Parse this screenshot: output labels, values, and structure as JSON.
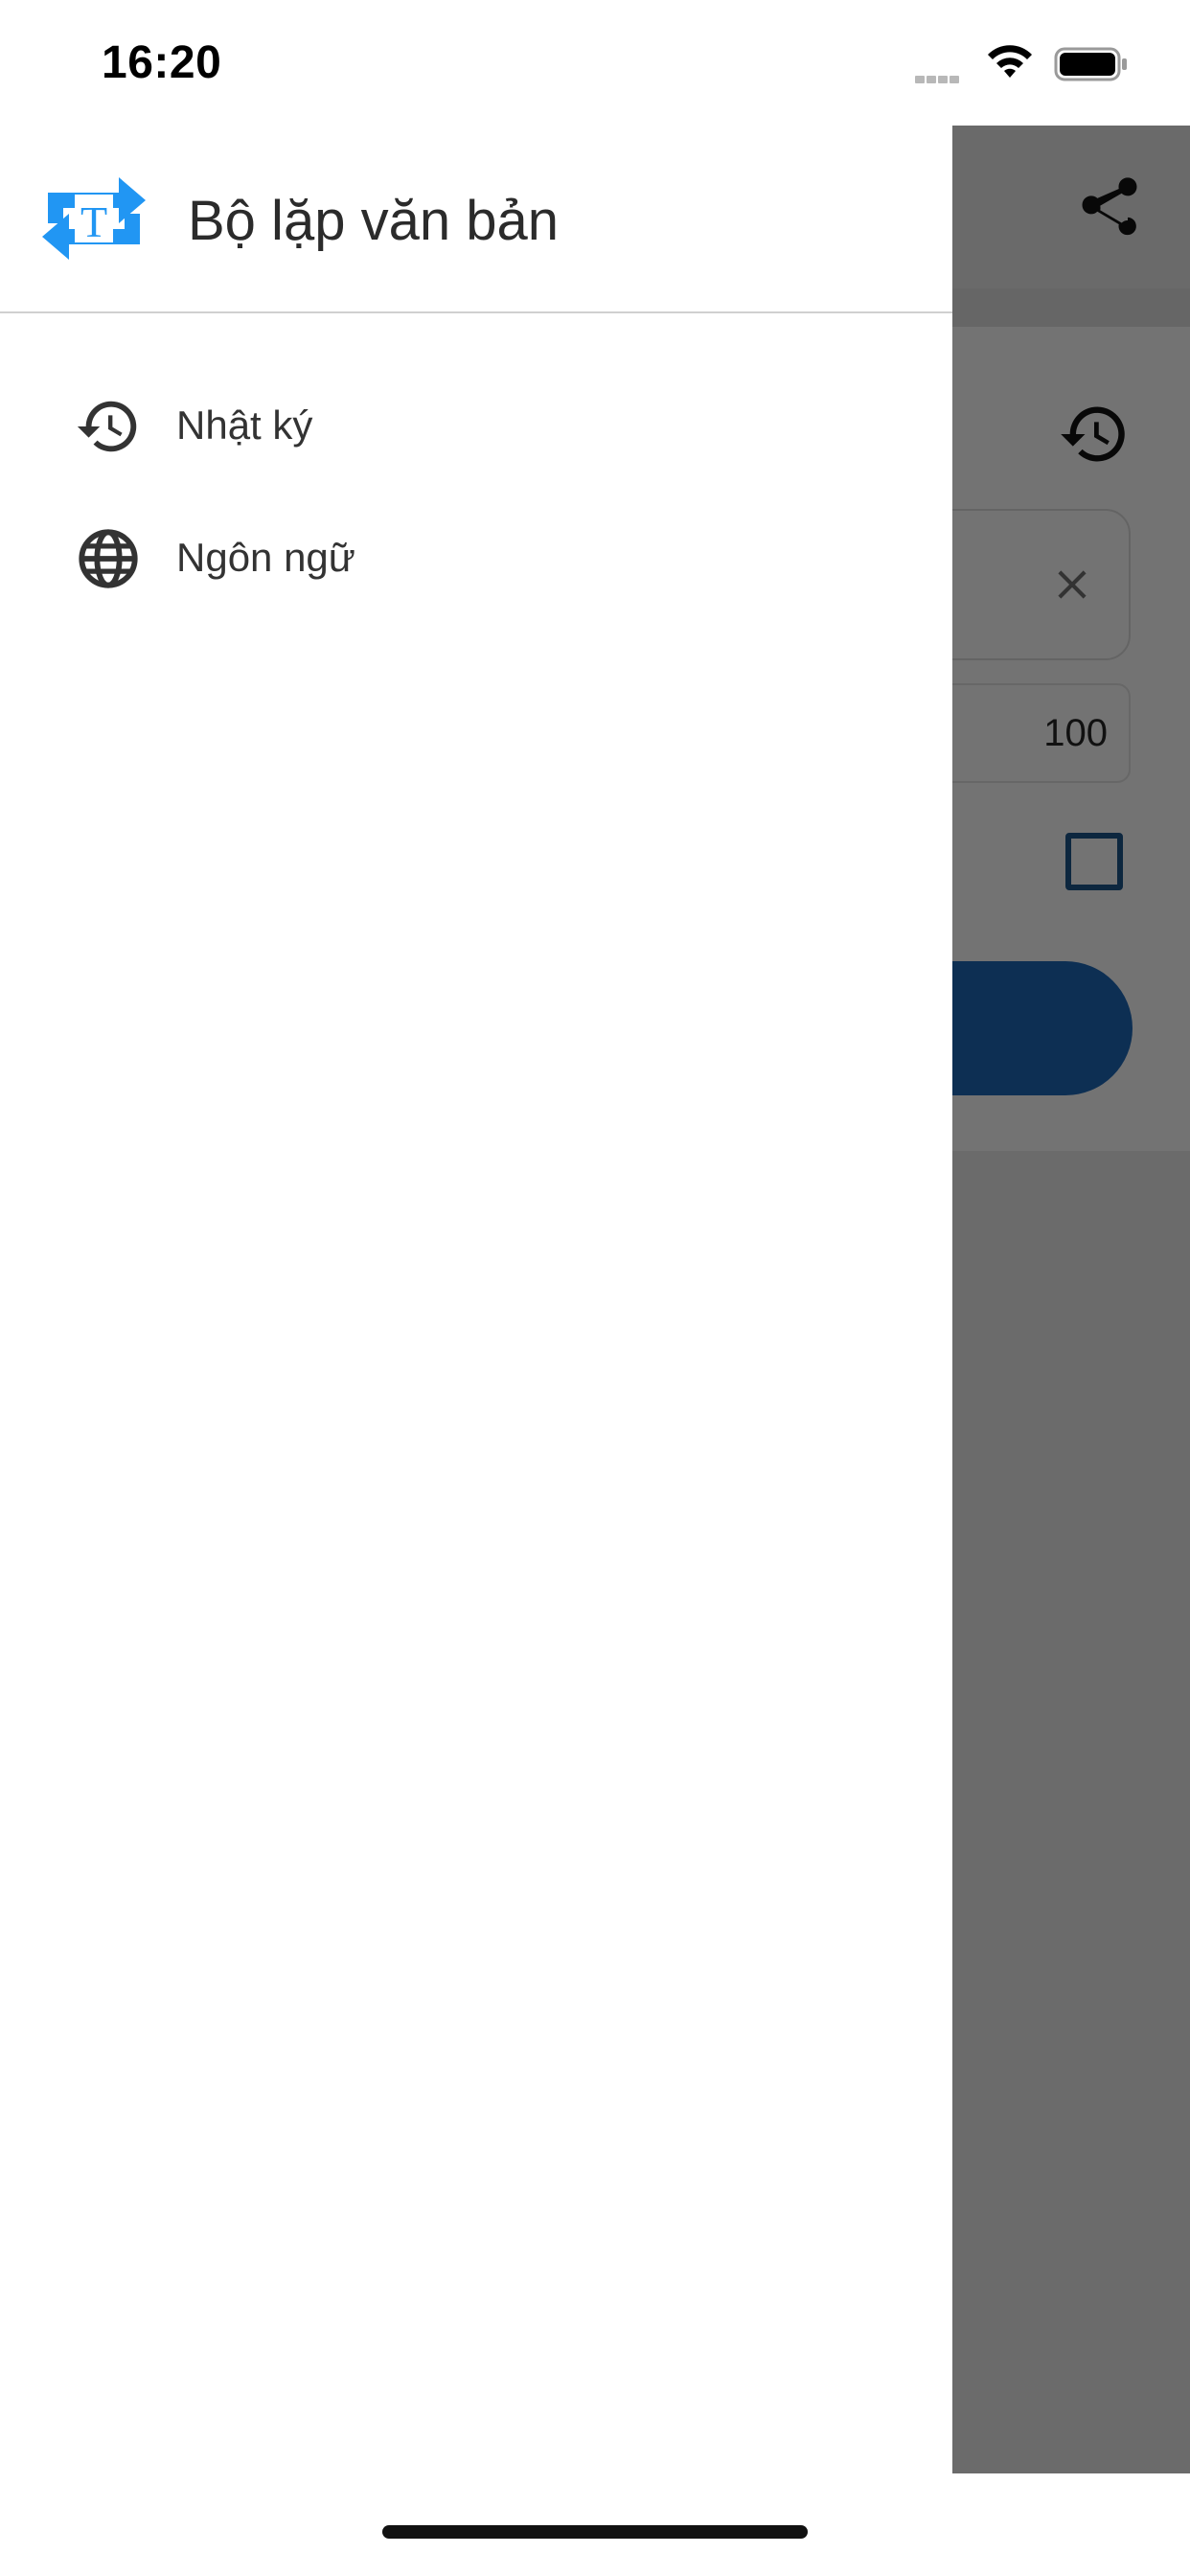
{
  "status_bar": {
    "time": "16:20",
    "icons": [
      "signal-dots",
      "wifi-icon",
      "battery-icon"
    ]
  },
  "drawer": {
    "app_title": "Bộ lặp văn bản",
    "logo_icon": "repeat-text-icon",
    "menu": [
      {
        "label": "Nhật ký",
        "icon": "history-icon"
      },
      {
        "label": "Ngôn ngữ",
        "icon": "globe-icon"
      }
    ]
  },
  "background": {
    "number_field_value": "100",
    "icons": [
      "share-icon",
      "history-icon",
      "close-icon"
    ]
  },
  "colors": {
    "accent": "#2196F3",
    "primary_button": "#1A5EA7",
    "checkbox": "#1B4E7F",
    "scrim": "rgba(0,0,0,0.5)"
  }
}
